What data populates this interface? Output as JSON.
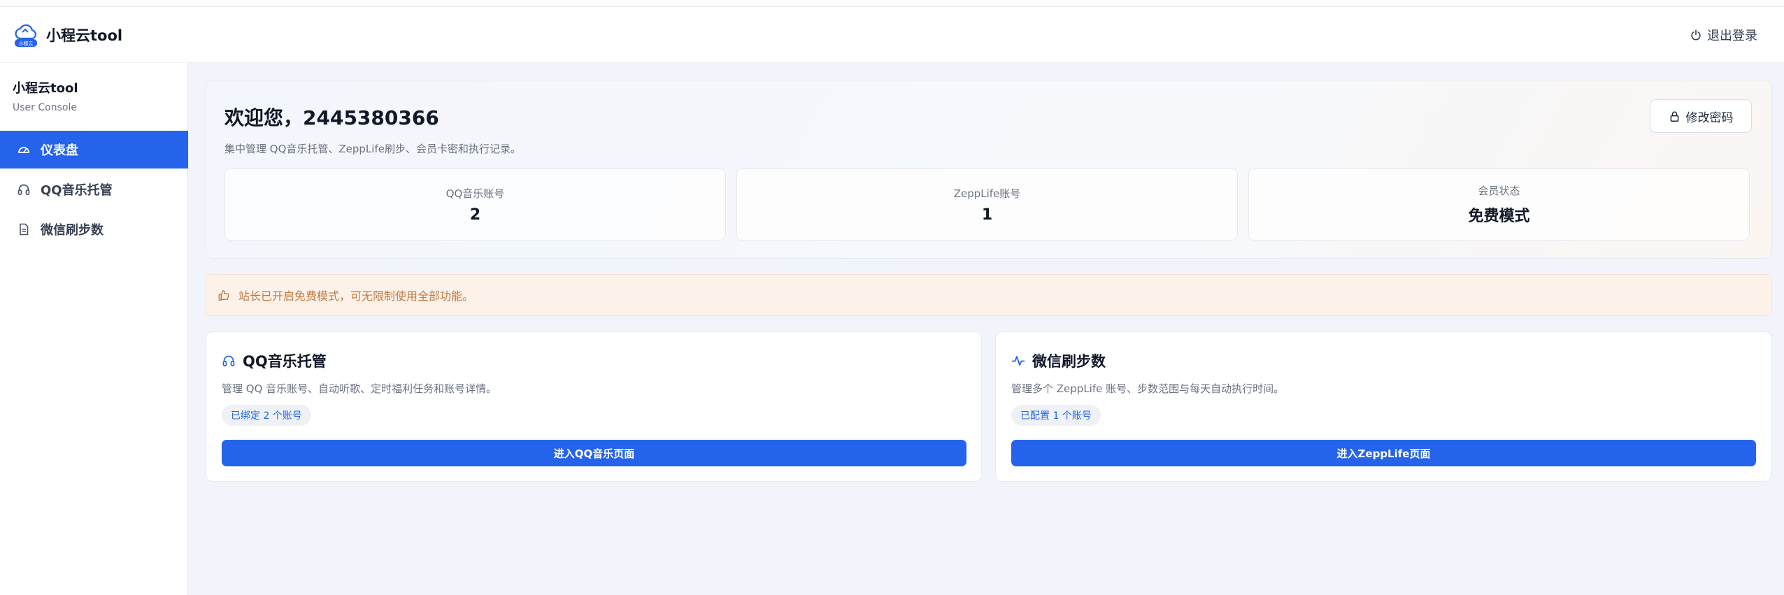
{
  "header": {
    "brand_name": "小程云tool",
    "logo_badge": "小程云",
    "logout_label": "退出登录"
  },
  "sidebar": {
    "title": "小程云tool",
    "subtitle": "User Console",
    "items": [
      {
        "label": "仪表盘",
        "icon": "dashboard-icon",
        "active": true
      },
      {
        "label": "QQ音乐托管",
        "icon": "headphones-icon",
        "active": false
      },
      {
        "label": "微信刷步数",
        "icon": "document-icon",
        "active": false
      }
    ]
  },
  "welcome": {
    "title": "欢迎您，2445380366",
    "description": "集中管理 QQ音乐托管、ZeppLife刷步、会员卡密和执行记录。",
    "change_password_label": "修改密码"
  },
  "stats": [
    {
      "label": "QQ音乐账号",
      "value": "2"
    },
    {
      "label": "ZeppLife账号",
      "value": "1"
    },
    {
      "label": "会员状态",
      "value": "免费模式"
    }
  ],
  "notice": {
    "text": "站长已开启免费模式，可无限制使用全部功能。"
  },
  "cards": [
    {
      "title": "QQ音乐托管",
      "icon": "headphones-icon",
      "description": "管理 QQ 音乐账号、自动听歌、定时福利任务和账号详情。",
      "badge": "已绑定 2 个账号",
      "button": "进入QQ音乐页面"
    },
    {
      "title": "微信刷步数",
      "icon": "activity-icon",
      "description": "管理多个 ZeppLife 账号、步数范围与每天自动执行时间。",
      "badge": "已配置 1 个账号",
      "button": "进入ZeppLife页面"
    }
  ],
  "colors": {
    "accent": "#2563eb",
    "notice_bg": "#fdf2e9",
    "notice_text": "#c2783e"
  }
}
